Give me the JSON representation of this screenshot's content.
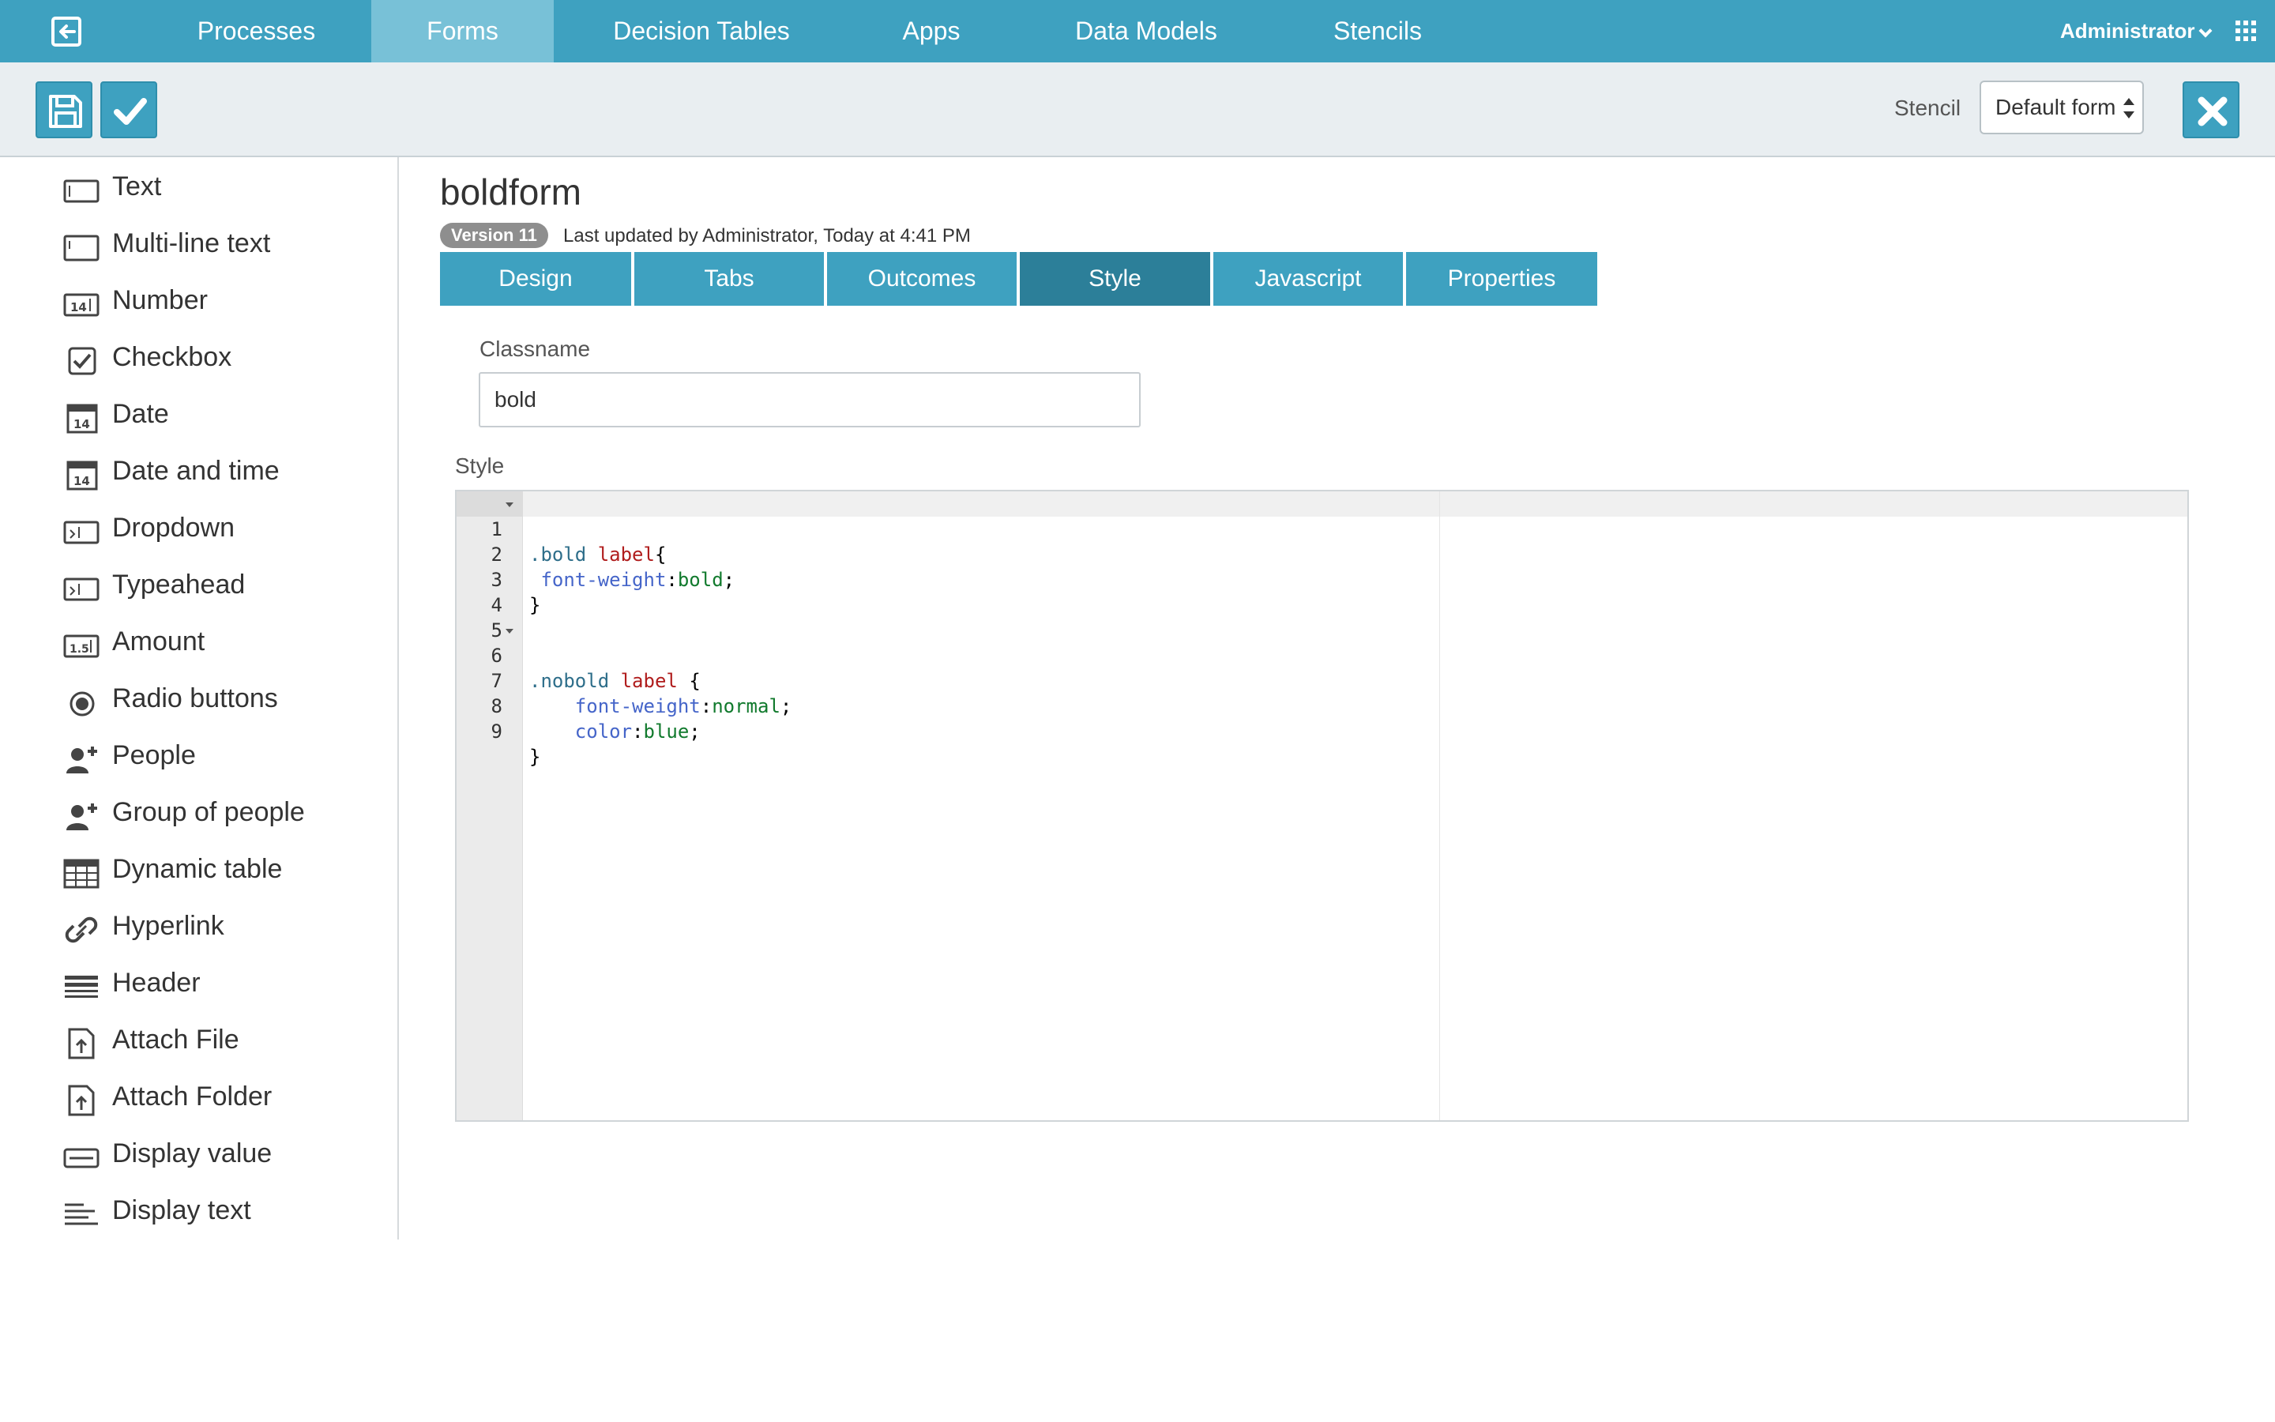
{
  "nav": {
    "items": [
      {
        "label": "Processes"
      },
      {
        "label": "Forms"
      },
      {
        "label": "Decision Tables"
      },
      {
        "label": "Apps"
      },
      {
        "label": "Data Models"
      },
      {
        "label": "Stencils"
      }
    ],
    "active": "Forms",
    "user": "Administrator"
  },
  "toolbar": {
    "stencil_label": "Stencil",
    "stencil_value": "Default form"
  },
  "palette": {
    "items": [
      {
        "label": "Text",
        "icon": "text-field-icon"
      },
      {
        "label": "Multi-line text",
        "icon": "multiline-text-icon"
      },
      {
        "label": "Number",
        "icon": "number-icon"
      },
      {
        "label": "Checkbox",
        "icon": "checkbox-icon"
      },
      {
        "label": "Date",
        "icon": "calendar-icon"
      },
      {
        "label": "Date and time",
        "icon": "calendar-icon"
      },
      {
        "label": "Dropdown",
        "icon": "dropdown-icon"
      },
      {
        "label": "Typeahead",
        "icon": "typeahead-icon"
      },
      {
        "label": "Amount",
        "icon": "amount-icon"
      },
      {
        "label": "Radio buttons",
        "icon": "radio-icon"
      },
      {
        "label": "People",
        "icon": "person-add-icon"
      },
      {
        "label": "Group of people",
        "icon": "group-add-icon"
      },
      {
        "label": "Dynamic table",
        "icon": "table-icon"
      },
      {
        "label": "Hyperlink",
        "icon": "link-icon"
      },
      {
        "label": "Header",
        "icon": "header-icon"
      },
      {
        "label": "Attach File",
        "icon": "attach-file-icon"
      },
      {
        "label": "Attach Folder",
        "icon": "attach-folder-icon"
      },
      {
        "label": "Display value",
        "icon": "display-value-icon"
      },
      {
        "label": "Display text",
        "icon": "display-text-icon"
      }
    ]
  },
  "form": {
    "title": "boldform",
    "version": "Version 11",
    "last_updated": "Last updated by Administrator, Today at 4:41 PM"
  },
  "tabs": [
    {
      "label": "Design"
    },
    {
      "label": "Tabs"
    },
    {
      "label": "Outcomes"
    },
    {
      "label": "Style"
    },
    {
      "label": "Javascript"
    },
    {
      "label": "Properties"
    }
  ],
  "active_tab": "Style",
  "style_tab": {
    "classname_label": "Classname",
    "classname_value": "bold",
    "style_label": "Style",
    "code_lines": [
      ".bold label{",
      " font-weight:bold;",
      "}",
      "",
      "",
      ".nobold label {",
      "    font-weight:normal;",
      "    color:blue;",
      "}"
    ],
    "line_numbers": [
      "1",
      "2",
      "3",
      "4",
      "5",
      "6",
      "7",
      "8",
      "9"
    ]
  },
  "colors": {
    "nav_bg": "#3ea1c0",
    "nav_active": "#78c1d7",
    "tab_active": "#2c7f99"
  }
}
